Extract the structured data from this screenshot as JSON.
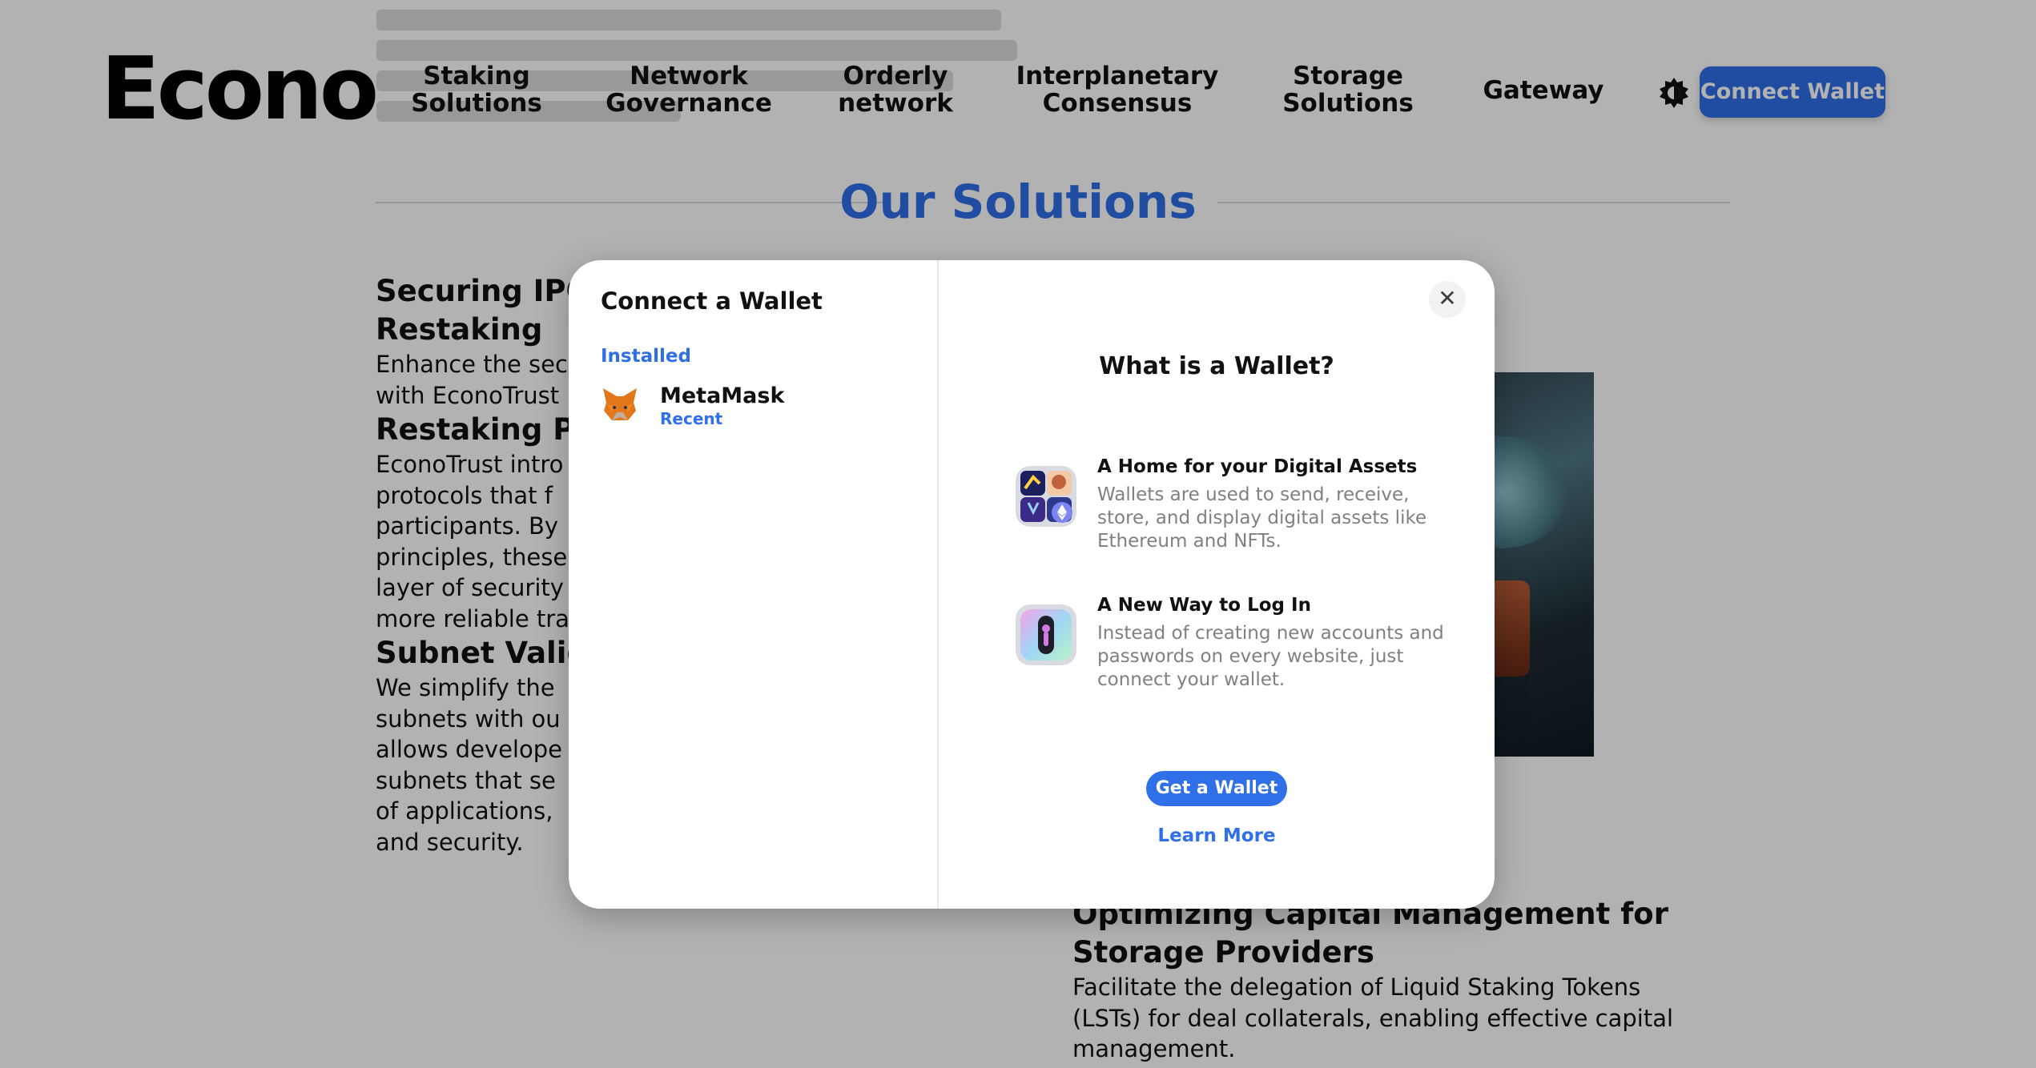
{
  "header": {
    "logo": "Econo",
    "nav": [
      "Staking\nSolutions",
      "Network\nGovernance",
      "Orderly\nnetwork",
      "Interplanetary\nConsensus",
      "Storage\nSolutions",
      "Gateway"
    ],
    "theme_icon": "theme-toggle-icon",
    "connect_label": "Connect Wallet"
  },
  "content": {
    "section_title": "Our Solutions",
    "left_blocks": [
      {
        "heading": "Securing IPC\nRestaking",
        "text": "Enhance the sec\nwith EconoTrust"
      },
      {
        "heading": "Restaking Pr",
        "text": "EconoTrust intro\nprotocols that f\nparticipants. By\nprinciples, these\nlayer of security\nmore reliable tra"
      },
      {
        "heading": "Subnet Valid",
        "text": "We simplify the\nsubnets with ou\nallows develope\nsubnets that se\nof applications,\nand security."
      }
    ],
    "right_block": {
      "heading": "Optimizing Capital Management for\nStorage Providers",
      "text": "Facilitate the delegation of Liquid Staking Tokens\n(LSTs) for deal collaterals, enabling effective capital\nmanagement."
    }
  },
  "modal": {
    "title": "Connect a Wallet",
    "installed_label": "Installed",
    "wallets": [
      {
        "name": "MetaMask",
        "tag": "Recent",
        "icon": "metamask-fox-icon"
      }
    ],
    "close_icon": "close-icon",
    "what_title": "What is a Wallet?",
    "info": [
      {
        "title": "A Home for your Digital Assets",
        "desc": "Wallets are used to send, receive, store, and display digital assets like Ethereum and NFTs.",
        "icon": "digital-assets-icon"
      },
      {
        "title": "A New Way to Log In",
        "desc": "Instead of creating new accounts and passwords on every website, just connect your wallet.",
        "icon": "login-key-icon"
      }
    ],
    "get_wallet": "Get a Wallet",
    "learn_more": "Learn More"
  },
  "colors": {
    "accent": "#2f6fe8",
    "overlay": "rgba(0,0,0,0.30)"
  }
}
